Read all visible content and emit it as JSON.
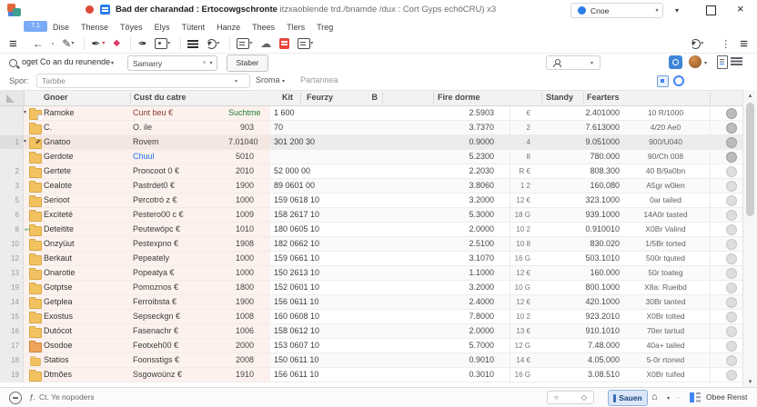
{
  "window": {
    "title_bold": "Bad der charandad : Ertocowgschronte",
    "title_rest": " itzxaoblende trd./bnamde /dux : Cort Gyps echöCRU) x3",
    "profile": "Cnoe"
  },
  "menubar": {
    "badge": "7.1",
    "items": [
      "Dise",
      "Thense",
      "Töyes",
      "Elys",
      "Tütent",
      "Hanze",
      "Thees",
      "Tlers",
      "Treg"
    ]
  },
  "filters": {
    "scope": "oget Co an du reunende",
    "combo_value": "Samarry",
    "search_button": "Staber",
    "row2_label": "Spor:",
    "row2_input": "Tarbbe",
    "row2_dropdown": "Sroma",
    "row2_static": "Partannea"
  },
  "table": {
    "headers": {
      "name": "Gnoer",
      "desc": "Cust du catre",
      "kit": "Kit",
      "feu": "Feurzy",
      "b": "B",
      "fire": "Fire dorme",
      "standy": "Standy",
      "fear": "Fearters"
    },
    "rows": [
      {
        "num": "",
        "exp": true,
        "folder": "page",
        "name": "Ramoke",
        "desc": "Cunt beu €",
        "desc_color": "maroon",
        "kit": "Suchtme",
        "kit_color": "green",
        "feu": "1 600",
        "b": "2.5903",
        "st": "€",
        "sta": "2.401000",
        "fear": "10 R/1000"
      },
      {
        "num": "",
        "folder": "plain",
        "name": "C.",
        "desc": "O. ile",
        "kit": "903",
        "feu": "70",
        "b": "3.7370",
        "st": "2",
        "sta": "7.613000",
        "fear": "4/20 Ae0"
      },
      {
        "num": "1",
        "exp": true,
        "sel": true,
        "folder": "pencil",
        "name": "Gnatoo",
        "desc": "Rovem",
        "kit": "7.01040",
        "feu": "301 200 30",
        "b": "0.9000",
        "st": "4",
        "sta": "9.051000",
        "fear": "900/U040"
      },
      {
        "num": "",
        "folder": "plain",
        "name": "Gerdote",
        "desc": "Chuul",
        "desc_color": "blue",
        "kit": "5010",
        "feu": "",
        "b": "5.2300",
        "st": "8",
        "sta": "780.000",
        "fear": "90/Ch 008"
      },
      {
        "num": "2",
        "folder": "plain",
        "name": "Gertete",
        "desc": "Proncoot 0 €",
        "kit": "2010",
        "feu": "52 000 00",
        "b": "2.2030",
        "st": "R €",
        "sta": "808.300",
        "fear": "40 B/9a0bn"
      },
      {
        "num": "3",
        "folder": "plain",
        "name": "Cealote",
        "desc": "Pastrdet0 €",
        "kit": "1900",
        "feu": "89 0601 00",
        "b": "3.8060",
        "st": "1 2",
        "sta": "160.080",
        "fear": "A5gr w0len"
      },
      {
        "num": "5",
        "folder": "plain",
        "name": "Serioot",
        "desc": "Percotró z €",
        "kit": "1000",
        "feu": "159 0618 10",
        "b": "3.2000",
        "st": "12 €",
        "sta": "323.1000",
        "fear": "0ar tailed"
      },
      {
        "num": "6",
        "folder": "plain",
        "name": "Exciteté",
        "desc": "Pestero00 c €",
        "kit": "1009",
        "feu": "158 2617 10",
        "b": "5.3000",
        "st": "18 G",
        "sta": "939.1000",
        "fear": "14A0r tasted"
      },
      {
        "num": "8",
        "folder": "greenarrow",
        "name": "Deteitite",
        "desc": "Peutewópc €",
        "kit": "1010",
        "feu": "180 0605 10",
        "b": "2.0000",
        "st": "10 2",
        "sta": "0.910010",
        "fear": "X0Br Valind"
      },
      {
        "num": "10",
        "folder": "plain",
        "name": "Onzyüut",
        "desc": "Pestexpno €",
        "kit": "1908",
        "feu": "182 0662 10",
        "b": "2.5100",
        "st": "10 8",
        "sta": "830.020",
        "fear": "1/5Br torted"
      },
      {
        "num": "12",
        "folder": "plain",
        "name": "Berkaut",
        "desc": "Pepeately",
        "kit": "1000",
        "feu": "159 0661 10",
        "b": "3.1070",
        "st": "16 G",
        "sta": "503.1010",
        "fear": "500r tquted"
      },
      {
        "num": "13",
        "folder": "plain",
        "name": "Onarotie",
        "desc": "Popeatya €",
        "kit": "1000",
        "feu": "150 2613 10",
        "b": "1.1000",
        "st": "12 €",
        "sta": "160.000",
        "fear": "50r toateg"
      },
      {
        "num": "19",
        "folder": "plain",
        "name": "Gotptse",
        "desc": "Pomoznos €",
        "kit": "1800",
        "feu": "152 0601 10",
        "b": "3.2000",
        "st": "10 G",
        "sta": "800.1000",
        "fear": "X8a: Rueibd"
      },
      {
        "num": "14",
        "folder": "plain",
        "name": "Getplea",
        "desc": "Ferroibsta €",
        "kit": "1900",
        "feu": "156 0611 10",
        "b": "2.4000",
        "st": "12 €",
        "sta": "420.1000",
        "fear": "30Br tanted"
      },
      {
        "num": "15",
        "folder": "plain",
        "name": "Exostus",
        "desc": "Sepseckgn €",
        "kit": "1008",
        "feu": "160 0608 10",
        "b": "7.8000",
        "st": "10 2",
        "sta": "923.2010",
        "fear": "X0Br tolted"
      },
      {
        "num": "16",
        "folder": "plain",
        "name": "Dutócot",
        "desc": "Fasenachr €",
        "kit": "1006",
        "feu": "158 0612 10",
        "b": "2.0000",
        "st": "13 €",
        "sta": "910.1010",
        "fear": "70er tartud"
      },
      {
        "num": "17",
        "folder": "orange",
        "name": "Osodoe",
        "desc": "Feotxeh00 €",
        "kit": "2000",
        "feu": "153 0607 10",
        "b": "5.7000",
        "st": "12 G",
        "sta": "7.48.000",
        "fear": "40a+ tailed"
      },
      {
        "num": "18",
        "folder": "small",
        "name": "Statios",
        "desc": "Foonsstigs €",
        "kit": "2008",
        "feu": "150 0611 10",
        "b": "0.9010",
        "st": "14 €",
        "sta": "4.05.000",
        "fear": "5-0r rtoned"
      },
      {
        "num": "19",
        "folder": "plain",
        "name": "Dtmões",
        "desc": "Ssgowoünz €",
        "kit": "1910",
        "feu": "156 0611 10",
        "b": "0.3010",
        "st": "16 G",
        "sta": "3.08.510",
        "fear": "X0Br tuifed"
      }
    ]
  },
  "statusbar": {
    "left_prefix": "ƒ.",
    "left_text": "Ct. Ye nopoders",
    "save_button": "Sauen",
    "view_label": "Obee Renst"
  },
  "colors": {
    "accent_blue": "#1a73e8",
    "folder_yellow": "#f2c261",
    "alert_red": "#e8453c",
    "green_text": "#1e7e34",
    "maroon_text": "#8a3a2e",
    "row_pink": "#fcf1ed"
  }
}
